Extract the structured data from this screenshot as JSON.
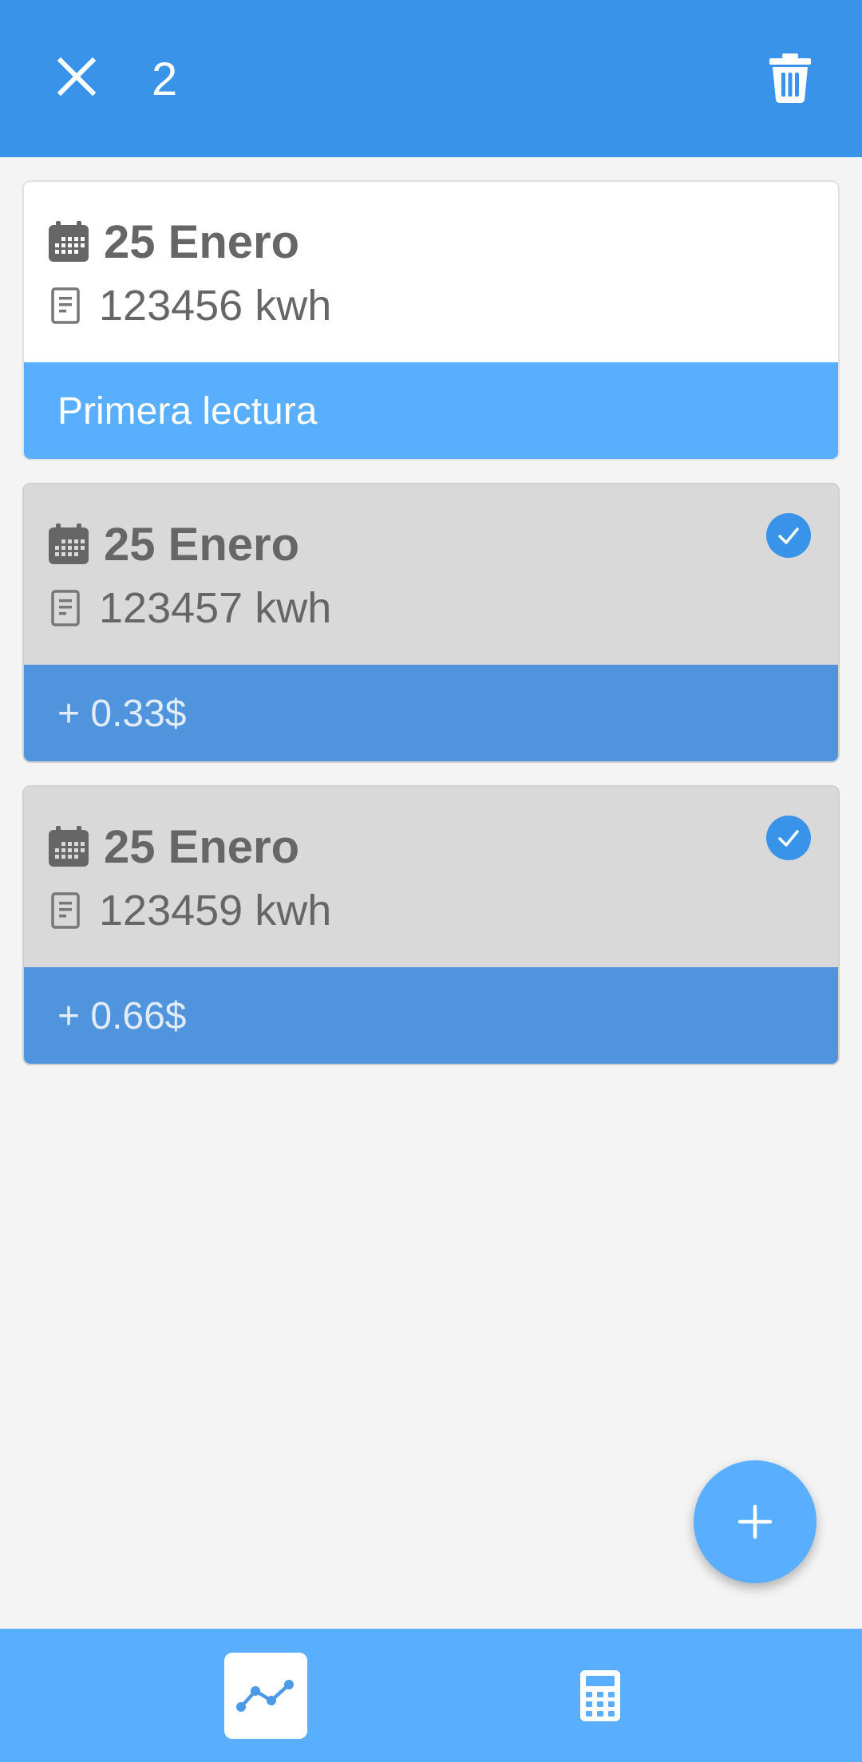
{
  "header": {
    "selected_count": "2",
    "close_icon": "close-icon",
    "delete_icon": "trash-icon",
    "color": "#3893e9"
  },
  "readings": [
    {
      "date": "25 Enero",
      "reading": "123456 kwh",
      "footer": "Primera lectura",
      "selected": false
    },
    {
      "date": "25 Enero",
      "reading": "123457 kwh",
      "footer": "+ 0.33$",
      "selected": true
    },
    {
      "date": "25 Enero",
      "reading": "123459 kwh",
      "footer": "+ 0.66$",
      "selected": true
    }
  ],
  "fab": {
    "icon": "plus-icon"
  },
  "bottom_nav": {
    "items": [
      {
        "icon": "line-chart-icon",
        "active": true
      },
      {
        "icon": "calculator-icon",
        "active": false
      }
    ],
    "color": "#59aefd"
  }
}
